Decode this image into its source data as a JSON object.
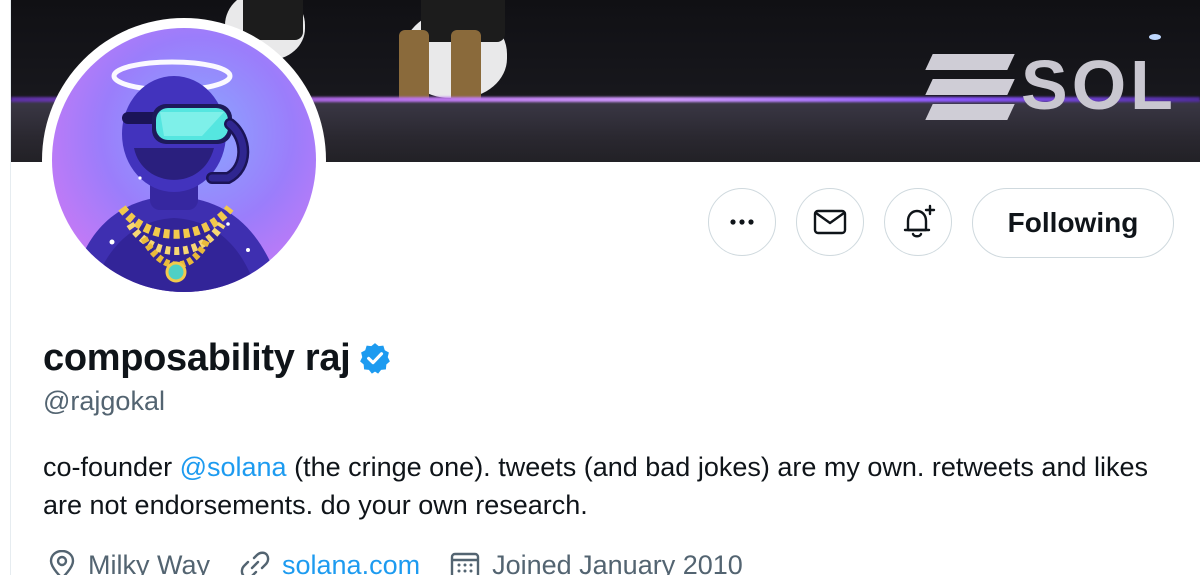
{
  "banner": {
    "brand_text": "SOL",
    "icon": "banner-photo"
  },
  "avatar": {
    "icon": "profile-avatar",
    "colors": {
      "bg_start": "#8aa8ff",
      "bg_end": "#d889f2"
    }
  },
  "actions": {
    "more_icon": "more-dots-icon",
    "message_icon": "envelope-icon",
    "notify_icon": "bell-plus-icon",
    "follow_label": "Following"
  },
  "profile": {
    "display_name": "composability raj",
    "verified_icon": "verified-badge-icon",
    "handle": "@rajgokal",
    "bio": {
      "prefix": "co-founder ",
      "mention": "@solana",
      "suffix": " (the cringe one). tweets (and bad jokes) are my own. retweets and likes are not endorsements. do your own research."
    },
    "location": "Milky Way",
    "website": "solana.com",
    "joined": "Joined January 2010"
  },
  "colors": {
    "accent": "#1d9bf0",
    "text_primary": "#0f1419",
    "text_secondary": "#536471",
    "border": "#cfd9de"
  }
}
